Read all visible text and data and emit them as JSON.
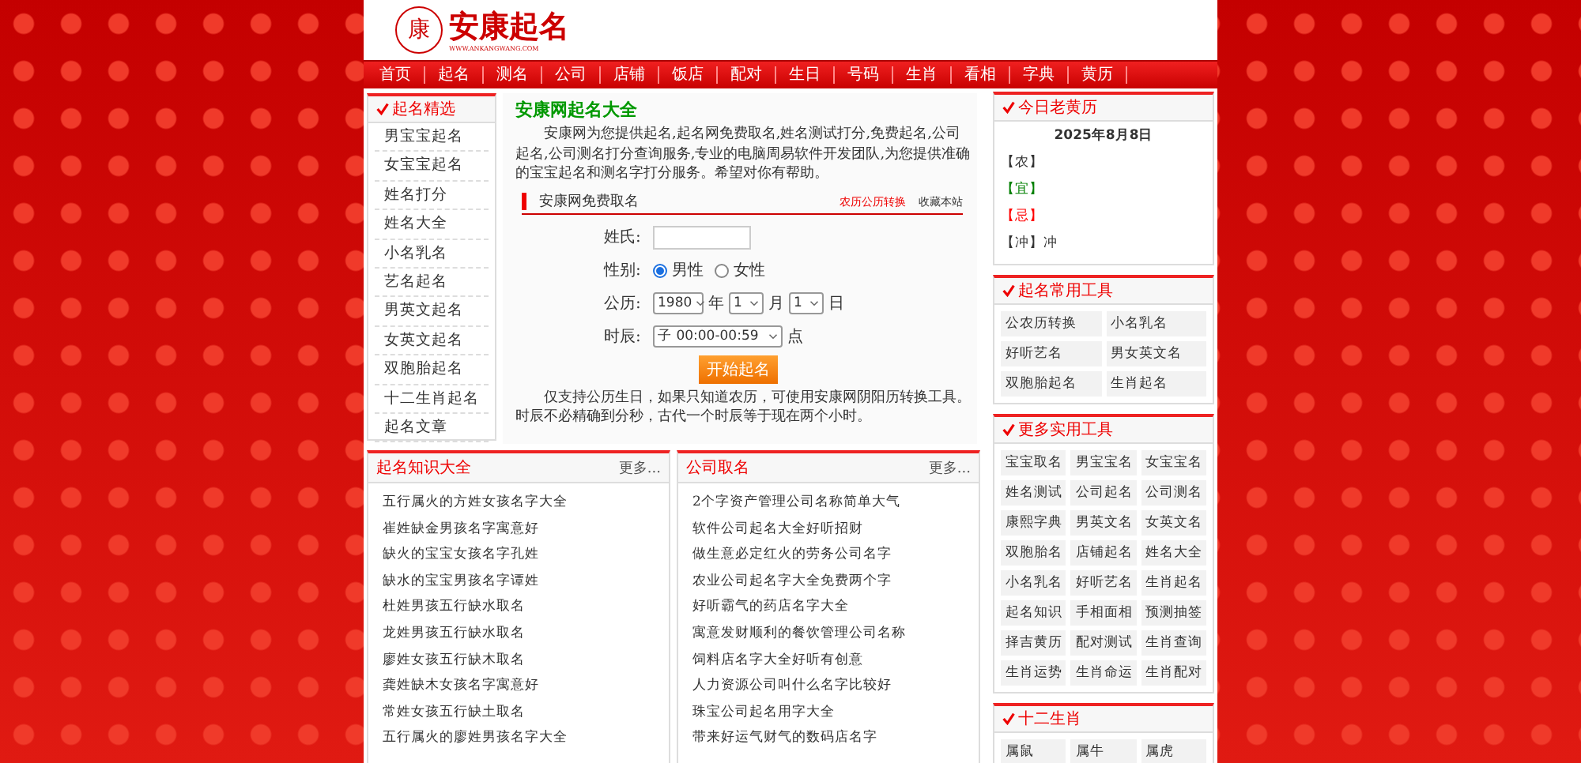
{
  "logo": {
    "seal": "康",
    "name": "安康起名",
    "url": "WWW.ANKANGWANG.COM"
  },
  "nav": [
    {
      "label": "首页",
      "selected": false
    },
    {
      "label": "起名",
      "selected": false
    },
    {
      "label": "测名",
      "selected": false
    },
    {
      "label": "公司",
      "selected": false
    },
    {
      "label": "店铺",
      "selected": false
    },
    {
      "label": "饭店",
      "selected": false
    },
    {
      "label": "配对",
      "selected": false
    },
    {
      "label": "生日",
      "selected": false
    },
    {
      "label": "号码",
      "selected": false
    },
    {
      "label": "生肖",
      "selected": false
    },
    {
      "label": "看相",
      "selected": false
    },
    {
      "label": "字典",
      "selected": false
    },
    {
      "label": "黄历",
      "selected": false
    }
  ],
  "sidebar": {
    "title": "起名精选",
    "items": [
      "男宝宝起名",
      "女宝宝起名",
      "姓名打分",
      "姓名大全",
      "小名乳名",
      "艺名起名",
      "男英文起名",
      "女英文起名",
      "双胞胎起名",
      "十二生肖起名",
      "起名文章"
    ]
  },
  "main": {
    "title": "安康网起名大全",
    "intro": "安康网为您提供起名,起名网免费取名,姓名测试打分,免费起名,公司起名,公司测名打分查询服务,专业的电脑周易软件开发团队,为您提供准确的宝宝起名和测名字打分服务。希望对你有帮助。",
    "form_title": "安康网免费取名",
    "links": [
      "农历公历转换",
      "收藏本站"
    ],
    "surname": {
      "label": "姓氏:"
    },
    "gender": {
      "label": "性别:",
      "options": [
        {
          "label": "男性",
          "selected": true
        },
        {
          "label": "女性",
          "selected": false
        }
      ]
    },
    "birth": {
      "label": "公历:",
      "year": "1980",
      "year_unit": "年",
      "month": "1",
      "month_unit": "月",
      "day": "1",
      "day_unit": "日"
    },
    "hour": {
      "label": "时辰:",
      "value": "子 00:00-00:59",
      "unit": "点"
    },
    "submit": "开始起名",
    "note": "仅支持公历生日，如果只知道农历，可使用安康网阴阳历转换工具。时辰不必精确到分秒，古代一个时辰等于现在两个小时。"
  },
  "articles": [
    {
      "title": "起名知识大全",
      "more": "更多...",
      "items": [
        "五行属火的方姓女孩名字大全",
        "崔姓缺金男孩名字寓意好",
        "缺火的宝宝女孩名字孔姓",
        "缺水的宝宝男孩名字谭姓",
        "杜姓男孩五行缺水取名",
        "龙姓男孩五行缺水取名",
        "廖姓女孩五行缺木取名",
        "龚姓缺木女孩名字寓意好",
        "常姓女孩五行缺土取名",
        "五行属火的廖姓男孩名字大全"
      ]
    },
    {
      "title": "公司取名",
      "more": "更多...",
      "items": [
        "2个字资产管理公司名称简单大气",
        "软件公司起名大全好听招财",
        "做生意必定红火的劳务公司名字",
        "农业公司起名字大全免费两个字",
        "好听霸气的药店名字大全",
        "寓意发财顺利的餐饮管理公司名称",
        "饲料店名字大全好听有创意",
        "人力资源公司叫什么名字比较好",
        "珠宝公司起名用字大全",
        "带来好运气财气的数码店名字"
      ]
    }
  ],
  "almanac": {
    "title": "今日老黄历",
    "date": "2025年8月8日",
    "lines": [
      {
        "text": "【农】",
        "color": "#333333"
      },
      {
        "text": "【宜】",
        "color": "#008000"
      },
      {
        "text": "【忌】",
        "color": "#ff0000"
      },
      {
        "text": "【冲】冲",
        "color": "#333333"
      }
    ]
  },
  "tools": {
    "title": "起名常用工具",
    "items": [
      "公农历转换",
      "小名乳名",
      "好听艺名",
      "男女英文名",
      "双胞胎起名",
      "生肖起名"
    ]
  },
  "more_tools": {
    "title": "更多实用工具",
    "items": [
      "宝宝取名",
      "男宝宝名",
      "女宝宝名",
      "姓名测试",
      "公司起名",
      "公司测名",
      "康熙字典",
      "男英文名",
      "女英文名",
      "双胞胎名",
      "店铺起名",
      "姓名大全",
      "小名乳名",
      "好听艺名",
      "生肖起名",
      "起名知识",
      "手相面相",
      "预测抽签",
      "择吉黄历",
      "配对测试",
      "生肖查询",
      "生肖运势",
      "生肖命运",
      "生肖配对"
    ]
  },
  "zodiac": {
    "title": "十二生肖",
    "items": [
      "属鼠",
      "属牛",
      "属虎"
    ]
  }
}
